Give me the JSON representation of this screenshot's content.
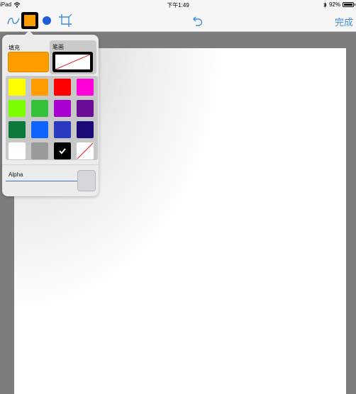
{
  "status_bar": {
    "device": "iPad",
    "time": "下午1:49",
    "battery": "92%"
  },
  "toolbar": {
    "pen_icon": "pen-curve-icon",
    "fill_icon": "fill-color-icon",
    "dot_icon": "brush-dot-icon",
    "crop_icon": "crop-icon",
    "undo_icon": "undo-icon",
    "done_label": "完成"
  },
  "colors": {
    "selected_fill": "#ff9c00",
    "accent": "#3c8ce0"
  },
  "popover": {
    "fill_tab_label": "填充",
    "stroke_tab_label": "笔画",
    "alpha_label": "Alpha",
    "swatches": [
      {
        "name": "yellow",
        "color": "#ffff00"
      },
      {
        "name": "orange",
        "color": "#ff9c00"
      },
      {
        "name": "red",
        "color": "#ff0000"
      },
      {
        "name": "magenta",
        "color": "#ff00d8"
      },
      {
        "name": "lime",
        "color": "#7aff00"
      },
      {
        "name": "green",
        "color": "#33c23a"
      },
      {
        "name": "purple",
        "color": "#a800cf"
      },
      {
        "name": "dark-purple",
        "color": "#6b0d96"
      },
      {
        "name": "dark-green",
        "color": "#0b7a3a"
      },
      {
        "name": "blue",
        "color": "#0d64ff"
      },
      {
        "name": "indigo",
        "color": "#2a39c0"
      },
      {
        "name": "navy",
        "color": "#1b0a78"
      },
      {
        "name": "white",
        "color": "#ffffff"
      },
      {
        "name": "gray",
        "color": "#9a9a9a"
      },
      {
        "name": "black",
        "color": "#000000",
        "selected": true
      },
      {
        "name": "none",
        "color": "none"
      }
    ]
  }
}
